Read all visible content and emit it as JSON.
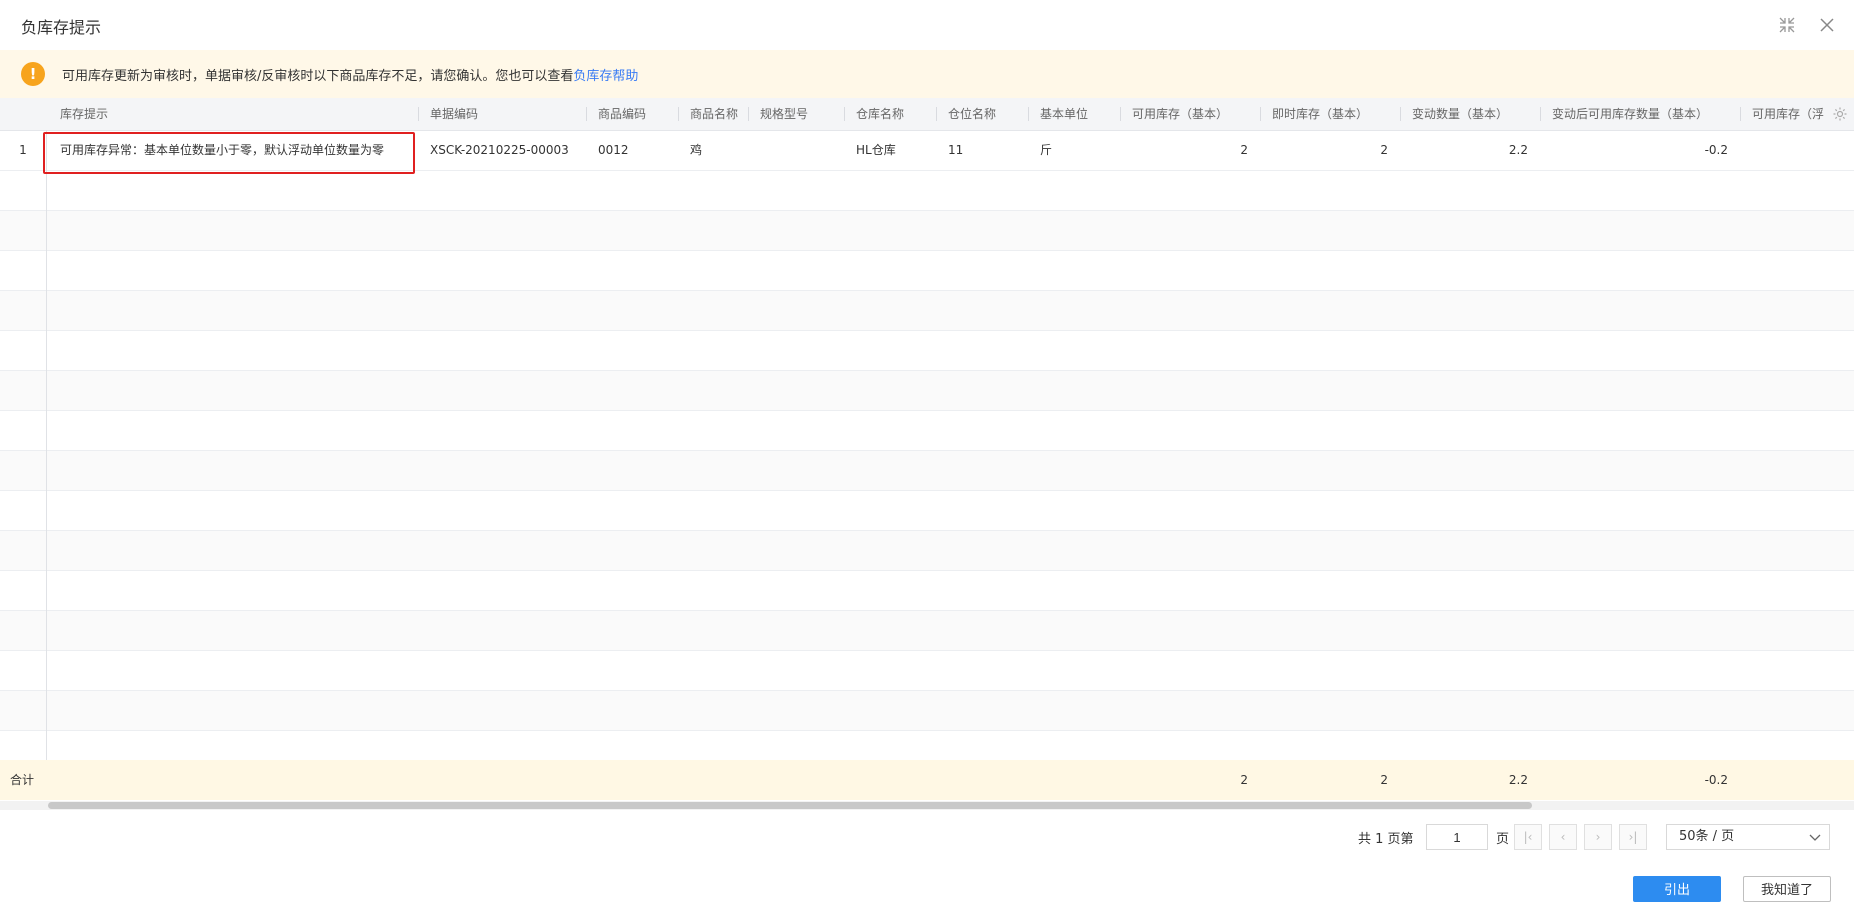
{
  "dialog": {
    "title": "负库存提示",
    "minimize_icon": "shrink-icon",
    "close_icon": "close-icon"
  },
  "alert": {
    "icon": "warning-icon",
    "color": "#f7a41d",
    "message": "可用库存更新为审核时，单据审核/反审核时以下商品库存不足，请您确认。您也可以查看",
    "link_label": "负库存帮助"
  },
  "table": {
    "columns": [
      {
        "key": "tip",
        "label": "库存提示"
      },
      {
        "key": "doc_code",
        "label": "单据编码"
      },
      {
        "key": "item_code",
        "label": "商品编码"
      },
      {
        "key": "item_name",
        "label": "商品名称"
      },
      {
        "key": "spec",
        "label": "规格型号"
      },
      {
        "key": "warehouse",
        "label": "仓库名称"
      },
      {
        "key": "location",
        "label": "仓位名称"
      },
      {
        "key": "unit",
        "label": "基本单位"
      },
      {
        "key": "available",
        "label": "可用库存（基本）"
      },
      {
        "key": "instant",
        "label": "即时库存（基本）"
      },
      {
        "key": "change",
        "label": "变动数量（基本）"
      },
      {
        "key": "after",
        "label": "变动后可用库存数量（基本）"
      },
      {
        "key": "available_float",
        "label": "可用库存（浮"
      }
    ],
    "rows": [
      {
        "index": "1",
        "tip": "可用库存异常：基本单位数量小于零，默认浮动单位数量为零",
        "doc_code": "XSCK-20210225-00003",
        "item_code": "0012",
        "item_name": "鸡",
        "spec": "",
        "warehouse": "HL仓库",
        "location": "11",
        "unit": "斤",
        "available": "2",
        "instant": "2",
        "change": "2.2",
        "after": "-0.2",
        "available_float": ""
      }
    ],
    "total": {
      "label": "合计",
      "available": "2",
      "instant": "2",
      "change": "2.2",
      "after": "-0.2"
    },
    "settings_icon": "gear-icon",
    "highlight_color": "#e02020"
  },
  "pager": {
    "prefix": "共 1 页第",
    "page": "1",
    "suffix": "页",
    "first_icon": "first-page-icon",
    "prev_icon": "chevron-left-icon",
    "next_icon": "chevron-right-icon",
    "last_icon": "last-page-icon",
    "page_size": "50条 / 页",
    "caret_icon": "chevron-down-icon"
  },
  "actions": {
    "export_label": "引出",
    "ok_label": "我知道了",
    "primary_color": "#2d8cf0"
  }
}
